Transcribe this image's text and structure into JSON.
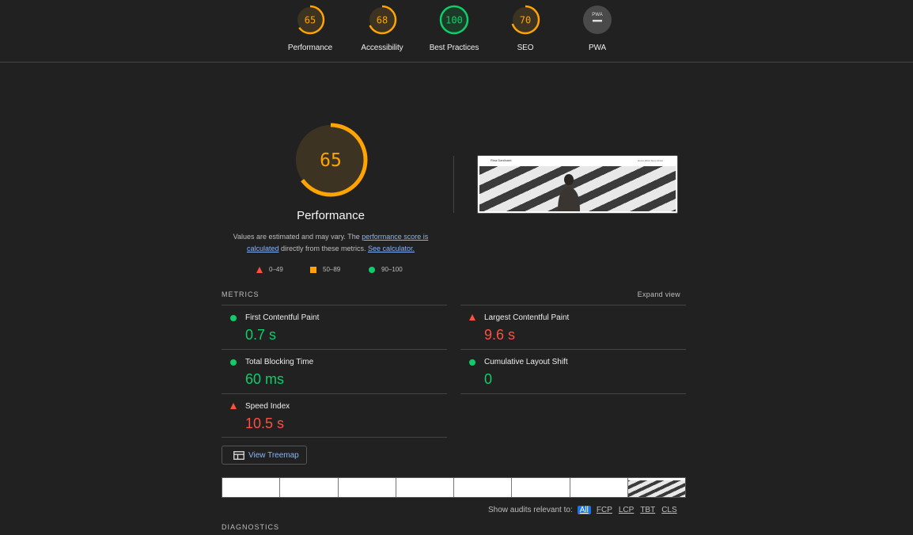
{
  "summary": [
    {
      "label": "Performance",
      "score": "65",
      "value": 65,
      "color": "#ffa400"
    },
    {
      "label": "Accessibility",
      "score": "68",
      "value": 68,
      "color": "#ffa400"
    },
    {
      "label": "Best Practices",
      "score": "100",
      "value": 100,
      "color": "#0cce6b"
    },
    {
      "label": "SEO",
      "score": "70",
      "value": 70,
      "color": "#ffa400"
    },
    {
      "label": "PWA",
      "score": "PWA",
      "value": null,
      "color": "#9e9e9e"
    }
  ],
  "performance": {
    "score": "65",
    "value": 65,
    "title": "Performance",
    "desc_prefix": "Values are estimated and may vary. The ",
    "desc_link1": "performance score is calculated",
    "desc_middle": " directly from these metrics. ",
    "desc_link2": "See calculator."
  },
  "legend": {
    "fail": "0–49",
    "average": "50–89",
    "pass": "90–100"
  },
  "screenshot": {
    "site_title": "Rina Daniloard",
    "nav_links": "Home  Work  Story  About"
  },
  "metrics": {
    "header": "METRICS",
    "expand_label": "Expand view",
    "items": [
      {
        "name": "First Contentful Paint",
        "value": "0.7 s",
        "status": "pass"
      },
      {
        "name": "Largest Contentful Paint",
        "value": "9.6 s",
        "status": "fail"
      },
      {
        "name": "Total Blocking Time",
        "value": "60 ms",
        "status": "pass"
      },
      {
        "name": "Cumulative Layout Shift",
        "value": "0",
        "status": "pass"
      },
      {
        "name": "Speed Index",
        "value": "10.5 s",
        "status": "fail"
      }
    ]
  },
  "treemap_button": "View Treemap",
  "audit_filter": {
    "label": "Show audits relevant to:",
    "options": [
      "All",
      "FCP",
      "LCP",
      "TBT",
      "CLS"
    ],
    "active": "All"
  },
  "diagnostics_header": "DIAGNOSTICS",
  "colors": {
    "pass": "#0cce6b",
    "average": "#ffa400",
    "fail": "#ff4e42",
    "link": "#8ab4f8",
    "background": "#212121"
  }
}
